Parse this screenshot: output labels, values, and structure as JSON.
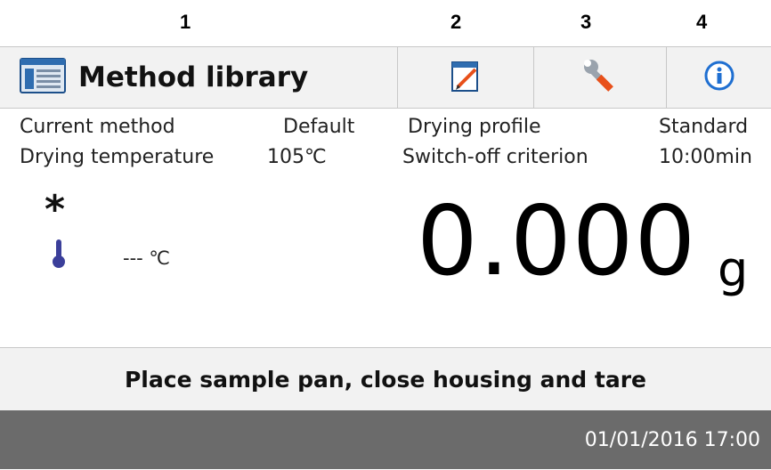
{
  "callouts": [
    "1",
    "2",
    "3",
    "4"
  ],
  "header": {
    "title": "Method library",
    "icons": [
      "method-library-icon",
      "edit-icon",
      "wrench-icon",
      "info-icon"
    ]
  },
  "info": {
    "current_method_label": "Current method",
    "current_method_value": "Default",
    "drying_profile_label": "Drying profile",
    "drying_profile_value": "Standard",
    "drying_temperature_label": "Drying temperature",
    "drying_temperature_value": "105℃",
    "switch_off_label": "Switch-off criterion",
    "switch_off_value": "10:00min"
  },
  "readout": {
    "stability_mark": "*",
    "temperature": "--- ℃",
    "weight": "0.000",
    "unit": "g"
  },
  "status_message": "Place sample pan, close housing and tare",
  "footer_datetime": "01/01/2016 17:00",
  "colors": {
    "header_bg": "#f2f2f2",
    "footer_bg": "#6b6b6b",
    "thermometer": "#3b3f9a",
    "wrench_accent": "#e8501a",
    "info_accent": "#1f6fd1"
  }
}
